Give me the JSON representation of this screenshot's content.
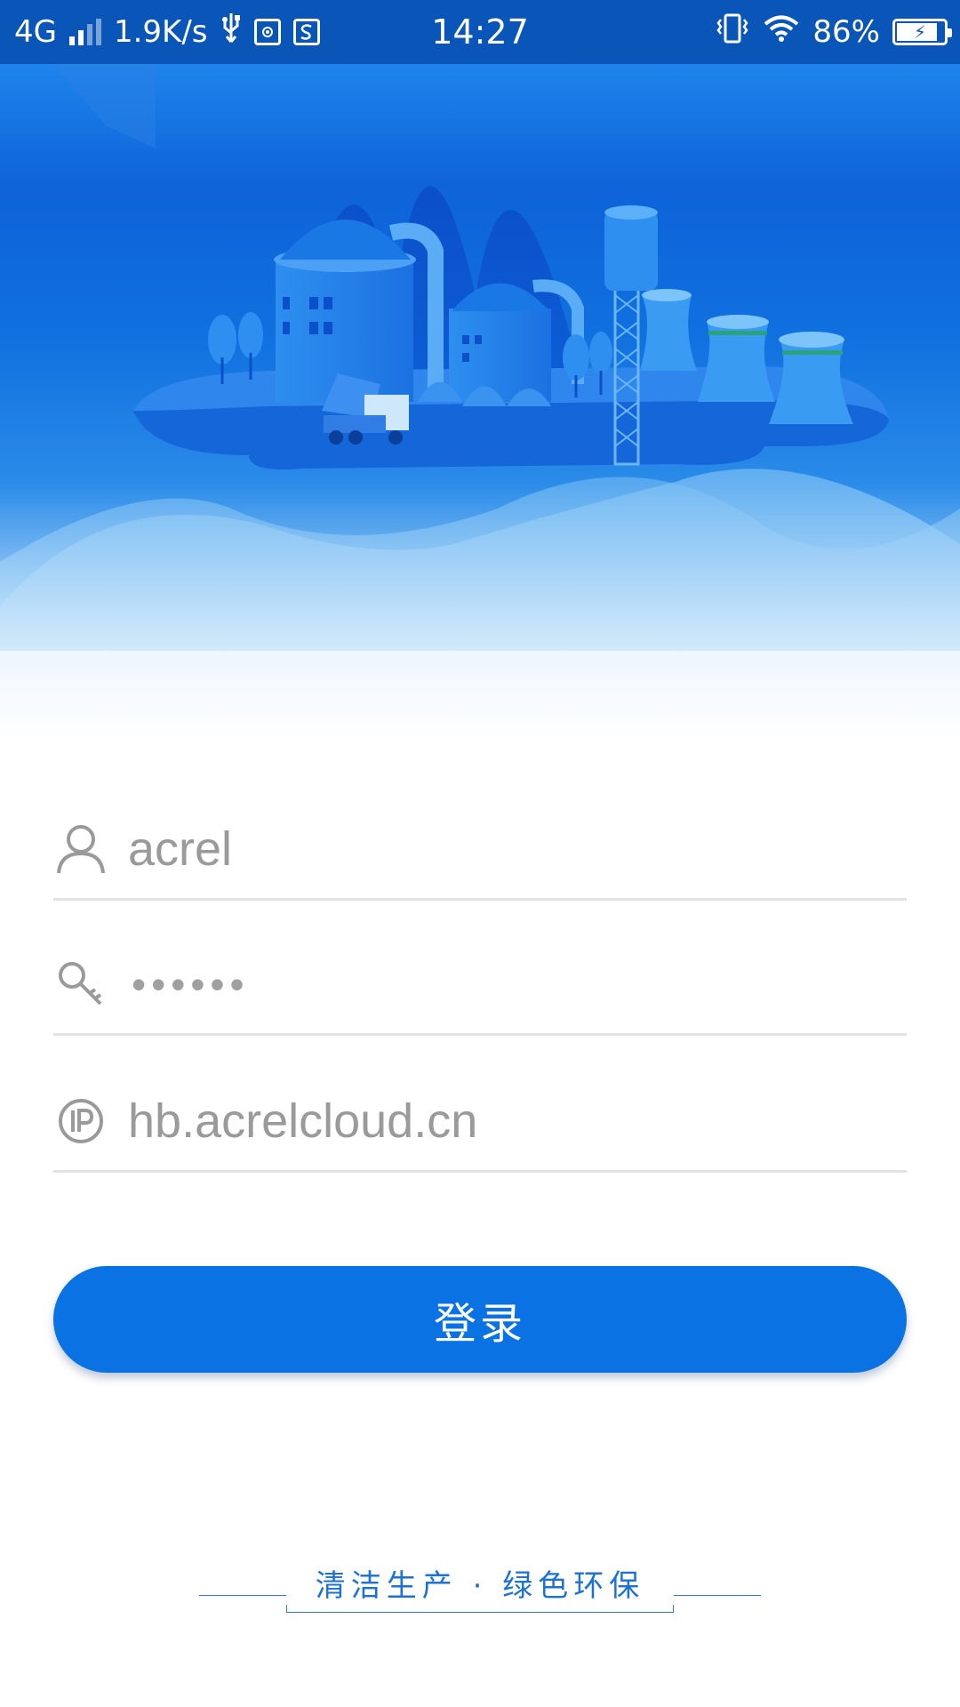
{
  "status_bar": {
    "network": "4G",
    "speed": "1.9K/s",
    "time": "14:27",
    "battery": "86%",
    "battery_level": 0.86
  },
  "form": {
    "username_value": "acrel",
    "password_mask": "••••••",
    "server_value": "hb.acrelcloud.cn"
  },
  "login_button_label": "登录",
  "slogan": "清洁生产 · 绿色环保",
  "colors": {
    "primary": "#0a72e3",
    "status_bar": "#0a56b8",
    "hint_text": "#9a9a9a"
  },
  "icons": [
    "user-icon",
    "key-icon",
    "ip-icon",
    "usb-icon",
    "vibrate-icon",
    "wifi-icon",
    "battery-icon"
  ]
}
